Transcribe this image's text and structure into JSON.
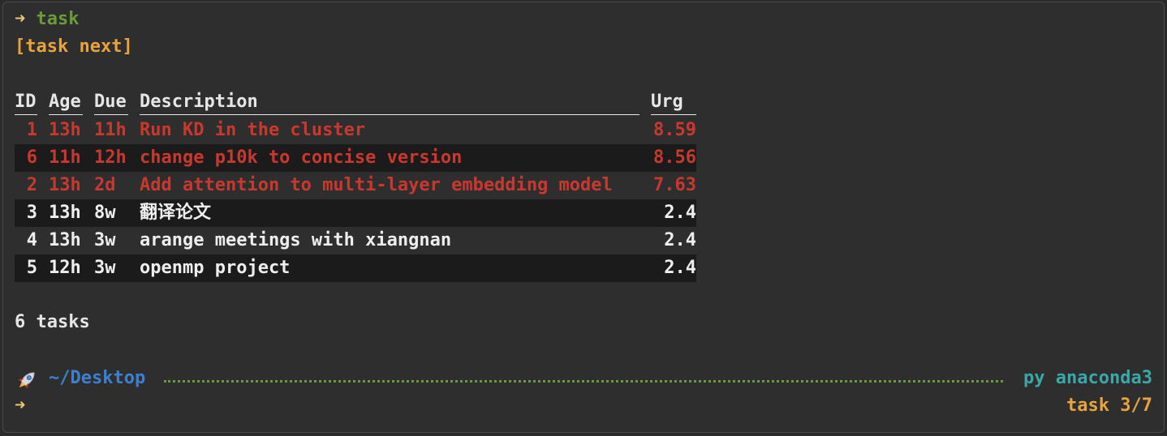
{
  "terminal": {
    "command_prompt": "➜",
    "command": "task",
    "report_name": "[task next]",
    "table": {
      "headers": {
        "id": "ID",
        "age": "Age",
        "due": "Due",
        "description": "Description",
        "urgency": "Urg"
      },
      "rows": [
        {
          "id": "1",
          "age": "13h",
          "due": "11h",
          "description": "Run KD in the cluster",
          "urgency": "8.59",
          "color": "#c9382e"
        },
        {
          "id": "6",
          "age": "11h",
          "due": "12h",
          "description": "change p10k to concise version",
          "urgency": "8.56",
          "color": "#c9382e"
        },
        {
          "id": "2",
          "age": "13h",
          "due": "2d",
          "description": "Add attention to multi-layer embedding model",
          "urgency": "7.63",
          "color": "#c9382e"
        },
        {
          "id": "3",
          "age": "13h",
          "due": "8w",
          "description": "翻译论文",
          "urgency": "2.4",
          "color": "#eeeeee"
        },
        {
          "id": "4",
          "age": "13h",
          "due": "3w",
          "description": "arange meetings with xiangnan",
          "urgency": "2.4",
          "color": "#eeeeee"
        },
        {
          "id": "5",
          "age": "12h",
          "due": "3w",
          "description": "openmp project",
          "urgency": "2.4",
          "color": "#eeeeee"
        }
      ]
    },
    "summary": "6 tasks",
    "prompt": {
      "icon": "rocket-icon",
      "path": "~/Desktop",
      "env_prefix": "py",
      "env_name": "anaconda3",
      "arrow": "➜",
      "task_status": "task 3/7"
    },
    "colors": {
      "background": "#2e2e2e",
      "urgent": "#c9382e",
      "report": "#e8a33d",
      "command": "#6b9a3d",
      "path": "#3d7fd0",
      "env": "#3aa8a8"
    }
  }
}
